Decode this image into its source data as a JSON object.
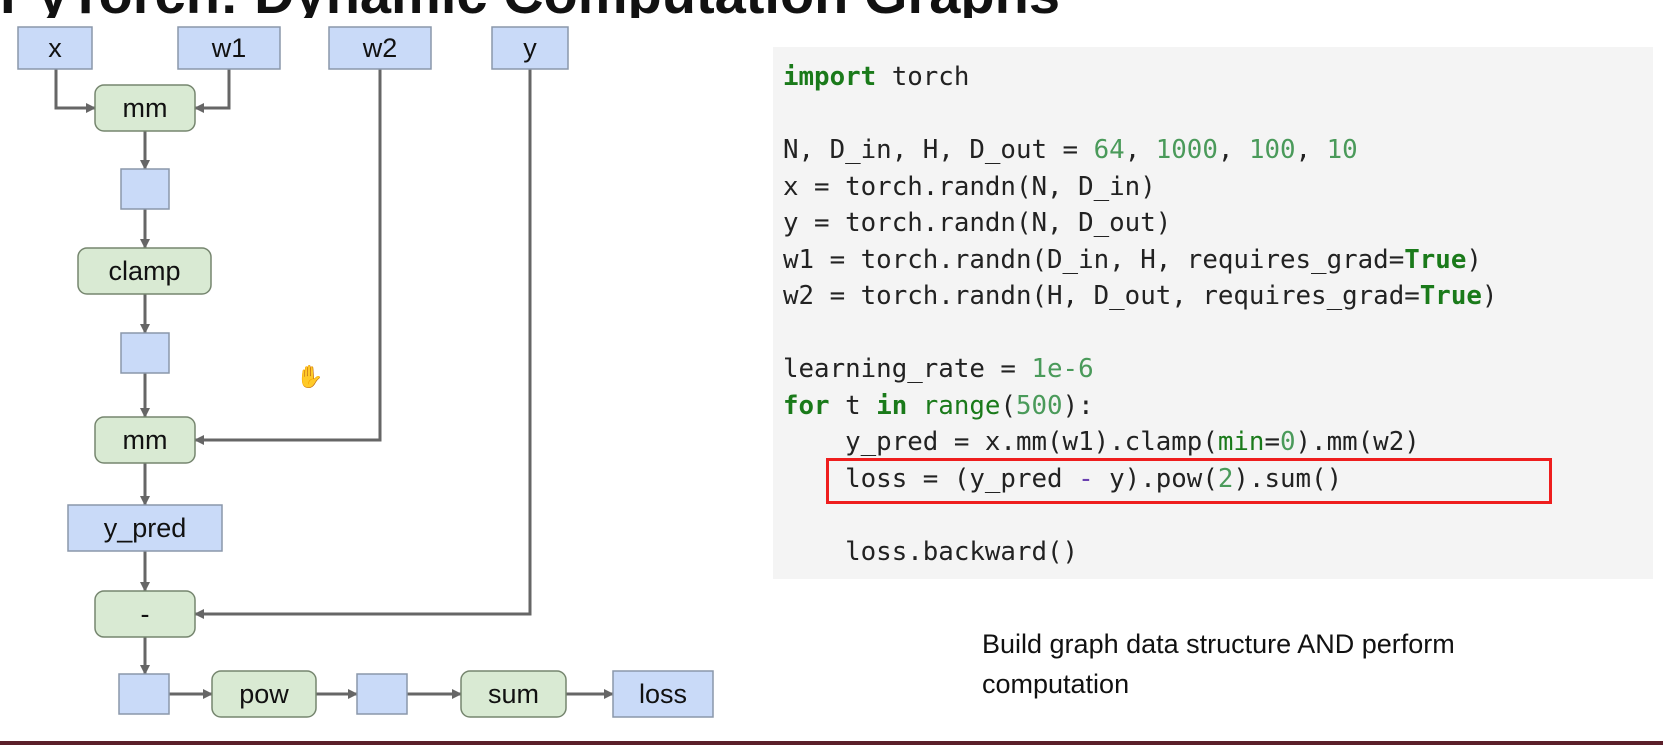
{
  "slide": {
    "title": "PyTorch: Dynamic Computation Graphs"
  },
  "graph": {
    "nodes": [
      {
        "id": "x",
        "label": "x",
        "kind": "var"
      },
      {
        "id": "w1",
        "label": "w1",
        "kind": "var"
      },
      {
        "id": "w2",
        "label": "w2",
        "kind": "var"
      },
      {
        "id": "y",
        "label": "y",
        "kind": "var"
      },
      {
        "id": "mm1",
        "label": "mm",
        "kind": "op"
      },
      {
        "id": "h1",
        "label": "",
        "kind": "var"
      },
      {
        "id": "clamp",
        "label": "clamp",
        "kind": "op"
      },
      {
        "id": "h2",
        "label": "",
        "kind": "var"
      },
      {
        "id": "mm2",
        "label": "mm",
        "kind": "op"
      },
      {
        "id": "y_pred",
        "label": "y_pred",
        "kind": "var"
      },
      {
        "id": "minus",
        "label": "-",
        "kind": "op"
      },
      {
        "id": "d",
        "label": "",
        "kind": "var"
      },
      {
        "id": "pow",
        "label": "pow",
        "kind": "op"
      },
      {
        "id": "p",
        "label": "",
        "kind": "var"
      },
      {
        "id": "sum",
        "label": "sum",
        "kind": "op"
      },
      {
        "id": "loss",
        "label": "loss",
        "kind": "var"
      }
    ],
    "edges": [
      [
        "x",
        "mm1"
      ],
      [
        "w1",
        "mm1"
      ],
      [
        "mm1",
        "h1"
      ],
      [
        "h1",
        "clamp"
      ],
      [
        "clamp",
        "h2"
      ],
      [
        "h2",
        "mm2"
      ],
      [
        "w2",
        "mm2"
      ],
      [
        "mm2",
        "y_pred"
      ],
      [
        "y_pred",
        "minus"
      ],
      [
        "y",
        "minus"
      ],
      [
        "minus",
        "d"
      ],
      [
        "d",
        "pow"
      ],
      [
        "pow",
        "p"
      ],
      [
        "p",
        "sum"
      ],
      [
        "sum",
        "loss"
      ]
    ]
  },
  "code": {
    "lines": [
      [
        {
          "t": "import",
          "c": "kw"
        },
        {
          "t": " torch"
        }
      ],
      [],
      [
        {
          "t": "N, D_in, H, D_out = "
        },
        {
          "t": "64",
          "c": "num"
        },
        {
          "t": ", "
        },
        {
          "t": "1000",
          "c": "num"
        },
        {
          "t": ", "
        },
        {
          "t": "100",
          "c": "num"
        },
        {
          "t": ", "
        },
        {
          "t": "10",
          "c": "num"
        }
      ],
      [
        {
          "t": "x = torch.randn(N, D_in)"
        }
      ],
      [
        {
          "t": "y = torch.randn(N, D_out)"
        }
      ],
      [
        {
          "t": "w1 = torch.randn(D_in, H, requires_grad="
        },
        {
          "t": "True",
          "c": "kw"
        },
        {
          "t": ")"
        }
      ],
      [
        {
          "t": "w2 = torch.randn(H, D_out, requires_grad="
        },
        {
          "t": "True",
          "c": "kw"
        },
        {
          "t": ")"
        }
      ],
      [],
      [
        {
          "t": "learning_rate = "
        },
        {
          "t": "1e-6",
          "c": "num"
        }
      ],
      [
        {
          "t": "for",
          "c": "kw"
        },
        {
          "t": " t "
        },
        {
          "t": "in",
          "c": "kw"
        },
        {
          "t": " "
        },
        {
          "t": "range",
          "c": "bi"
        },
        {
          "t": "("
        },
        {
          "t": "500",
          "c": "num"
        },
        {
          "t": "):"
        }
      ],
      [
        {
          "t": "    y_pred = x.mm(w1).clamp("
        },
        {
          "t": "min",
          "c": "bi"
        },
        {
          "t": "="
        },
        {
          "t": "0",
          "c": "num"
        },
        {
          "t": ").mm(w2)"
        }
      ],
      [
        {
          "t": "    loss = (y_pred "
        },
        {
          "t": "-",
          "c": "mn"
        },
        {
          "t": " y).pow("
        },
        {
          "t": "2",
          "c": "num"
        },
        {
          "t": ").sum()"
        }
      ],
      [],
      [
        {
          "t": "    loss.backward()"
        }
      ]
    ],
    "highlighted_line": 11
  },
  "caption": "Build graph data structure AND perform computation"
}
